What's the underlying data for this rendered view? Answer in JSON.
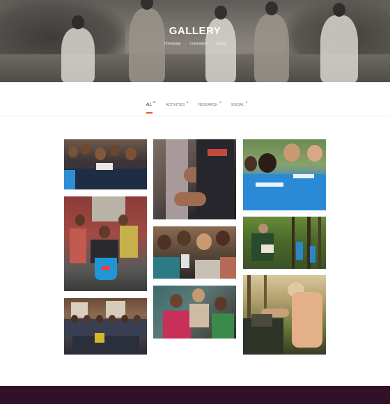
{
  "hero": {
    "title": "GALLERY",
    "breadcrumb": [
      "Homepage",
      "Campaigns",
      "Listing"
    ],
    "separator": "-"
  },
  "filters": [
    {
      "label": "ALL",
      "count": "10",
      "active": true
    },
    {
      "label": "ACTIVITIES",
      "count": "4",
      "active": false
    },
    {
      "label": "RESEARCH",
      "count": "3",
      "active": false
    },
    {
      "label": "SOCIAL",
      "count": "2",
      "active": false
    }
  ],
  "colors": {
    "accent": "#e8562a",
    "footer": "#32102a"
  }
}
